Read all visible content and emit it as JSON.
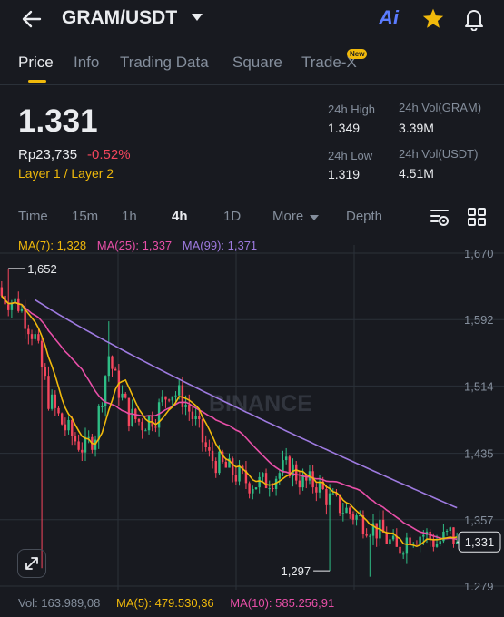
{
  "header": {
    "pair": "GRAM/USDT",
    "ai_label": "Ai"
  },
  "tabs": [
    {
      "label": "Price"
    },
    {
      "label": "Info"
    },
    {
      "label": "Trading Data"
    },
    {
      "label": "Square"
    },
    {
      "label": "Trade-X"
    }
  ],
  "new_badge": "New",
  "ticker": {
    "price": "1.331",
    "fiat": "Rp23,735",
    "change": "-0.52%",
    "tag": "Layer 1 / Layer 2",
    "high_label": "24h High",
    "high": "1.349",
    "low_label": "24h Low",
    "low": "1.319",
    "vol_base_label": "24h Vol(GRAM)",
    "vol_base": "3.39M",
    "vol_quote_label": "24h Vol(USDT)",
    "vol_quote": "4.51M"
  },
  "intervals": [
    {
      "label": "Time"
    },
    {
      "label": "15m"
    },
    {
      "label": "1h"
    },
    {
      "label": "4h"
    },
    {
      "label": "1D"
    },
    {
      "label": "More"
    },
    {
      "label": "Depth"
    }
  ],
  "ma_legend": {
    "ma7": "MA(7): 1,328",
    "ma25": "MA(25): 1,337",
    "ma99": "MA(99): 1,371"
  },
  "colors": {
    "up": "#2ebd85",
    "down": "#f6465d",
    "ma7": "#f0b90b",
    "ma25": "#e84fa8",
    "ma99": "#9e7ae0",
    "accent": "#f0b90b"
  },
  "chart_data": {
    "type": "candlestick",
    "yticks": [
      "1,670",
      "1,592",
      "1,514",
      "1,435",
      "1,357",
      "1,279"
    ],
    "ylim": [
      1.27,
      1.68
    ],
    "watermark": "BINANCE",
    "high_marker": {
      "label": "1,652",
      "index": 2,
      "value": 1.652
    },
    "low_marker": {
      "label": "1,297",
      "index": 98,
      "value": 1.297
    },
    "last_price_label": "1,331",
    "last_price": 1.331,
    "candles": [],
    "ma7": [],
    "ma25": [],
    "ma99": []
  },
  "volume_legend": {
    "vol": "Vol: 163.989,08",
    "ma5": "MA(5): 479.530,36",
    "ma10": "MA(10): 585.256,91"
  }
}
